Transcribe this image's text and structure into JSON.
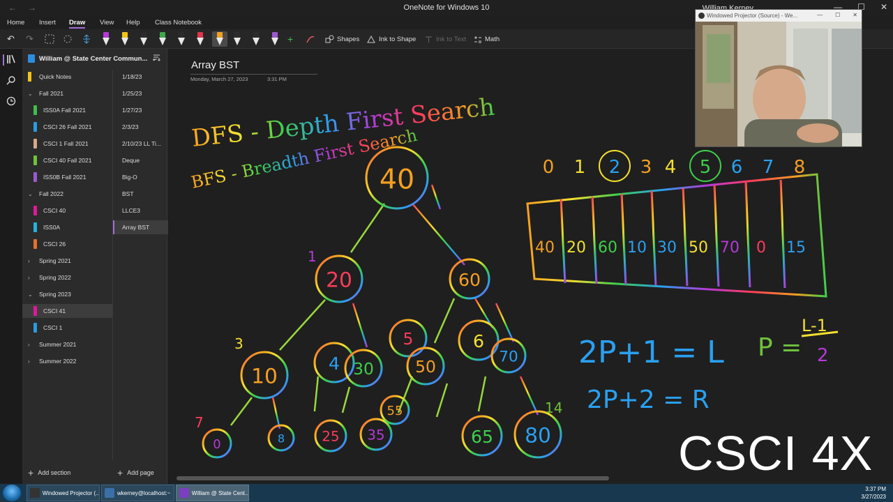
{
  "window": {
    "title": "OneNote for Windows 10",
    "user": "William Kerney",
    "back_glyph": "←",
    "forward_glyph": "→",
    "minimize_glyph": "—",
    "maximize_glyph": "☐",
    "close_glyph": "✕"
  },
  "menu": {
    "tabs": [
      "Home",
      "Insert",
      "Draw",
      "View",
      "Help",
      "Class Notebook"
    ],
    "active": "Draw"
  },
  "ribbon": {
    "undo": "↶",
    "redo": "↷",
    "shapes_label": "Shapes",
    "ink_to_shape_label": "Ink to Shape",
    "ink_to_text_label": "Ink to Text",
    "math_label": "Math",
    "pens": [
      {
        "color": "#b23ad6",
        "icon": "pen-icon"
      },
      {
        "color": "#f0c419",
        "icon": "highlighter-icon"
      },
      {
        "color": "#2b2b2b",
        "icon": "pen-icon"
      },
      {
        "color": "#3fa84a",
        "icon": "pen-icon"
      },
      {
        "color": "#2b2b2b",
        "icon": "pen-icon"
      },
      {
        "color": "#e1344b",
        "icon": "pen-icon"
      },
      {
        "color": "#f4a020",
        "icon": "rainbow-pen-icon"
      },
      {
        "color": "#2b2b2b",
        "icon": "pen-icon"
      },
      {
        "color": "#2b2b2b",
        "icon": "pen-icon"
      },
      {
        "color": "#9b59d0",
        "icon": "pen-icon"
      }
    ]
  },
  "notebook": {
    "name": "William @ State Center Commun...",
    "sections": [
      {
        "label": "Quick Notes",
        "color": "#f0c419",
        "type": "section"
      },
      {
        "label": "Fall 2021",
        "type": "group",
        "expanded": true
      },
      {
        "label": "ISS0A Fall 2021",
        "color": "#3fbf4a",
        "type": "section"
      },
      {
        "label": "CSCI 26 Fall 2021",
        "color": "#2a9be0",
        "type": "section"
      },
      {
        "label": "CSCI 1 Fall 2021",
        "color": "#d4a88a",
        "type": "section"
      },
      {
        "label": "CSCI 40 Fall 2021",
        "color": "#6fc23a",
        "type": "section"
      },
      {
        "label": "ISS0B Fall 2021",
        "color": "#9c59d1",
        "type": "section"
      },
      {
        "label": "Fall 2022",
        "type": "group",
        "expanded": true
      },
      {
        "label": "CSCI 40",
        "color": "#e0189a",
        "type": "section"
      },
      {
        "label": "ISS0A",
        "color": "#22b3e0",
        "type": "section"
      },
      {
        "label": "CSCI 26",
        "color": "#e8702a",
        "type": "section"
      },
      {
        "label": "Spring 2021",
        "type": "group",
        "expanded": false
      },
      {
        "label": "Spring 2022",
        "type": "group",
        "expanded": false
      },
      {
        "label": "Spring 2023",
        "type": "group",
        "expanded": true
      },
      {
        "label": "CSCI 41",
        "color": "#e0189a",
        "type": "section",
        "selected": true
      },
      {
        "label": "CSCI 1",
        "color": "#2a9be0",
        "type": "section"
      },
      {
        "label": "Summer 2021",
        "type": "group",
        "expanded": false
      },
      {
        "label": "Summer 2022",
        "type": "group",
        "expanded": false
      }
    ],
    "pages": [
      "1/18/23",
      "1/25/23",
      "1/27/23",
      "2/3/23",
      "2/10/23 LL Ti...",
      "Deque",
      "Big-O",
      "BST",
      "LLCE3",
      "Array BST"
    ],
    "selected_page": "Array BST",
    "add_section": "Add section",
    "add_page": "Add page"
  },
  "page": {
    "title": "Array BST",
    "date": "Monday, March 27, 2023",
    "time": "3:31 PM"
  },
  "ink": {
    "heading1": "DFS - Depth First Search",
    "heading2": "BFS - Breadth First Search",
    "tree_nodes": [
      "40",
      "20",
      "60",
      "10",
      "4",
      "30",
      "5",
      "50",
      "6",
      "70",
      "0",
      "8",
      "25",
      "35",
      "55",
      "65",
      "80"
    ],
    "index_labels": [
      "0",
      "1",
      "2",
      "3",
      "4",
      "5",
      "6",
      "7",
      "8"
    ],
    "array_cells": [
      "40",
      "20",
      "60",
      "10",
      "30",
      "50",
      "70",
      "0",
      "15"
    ],
    "formula1": "2P+1 = L",
    "formula2": "2P+2 = R",
    "formula3": "P =",
    "formula3_num": "L-1",
    "formula3_den": "2",
    "margin_marks": [
      "1",
      "3",
      "7",
      "14"
    ]
  },
  "overlay": {
    "camera_title": "Windowed Projector (Source) - We...",
    "watermark": "CSCI 4X"
  },
  "taskbar": {
    "items": [
      {
        "label": "Windowed Projector (...",
        "color": "#333"
      },
      {
        "label": "wkerney@localhost:~",
        "color": "#3b6fa8"
      },
      {
        "label": "William @ State Cent...",
        "color": "#7b3fbf",
        "active": true
      }
    ],
    "time": "3:37 PM",
    "date": "3/27/2023"
  }
}
